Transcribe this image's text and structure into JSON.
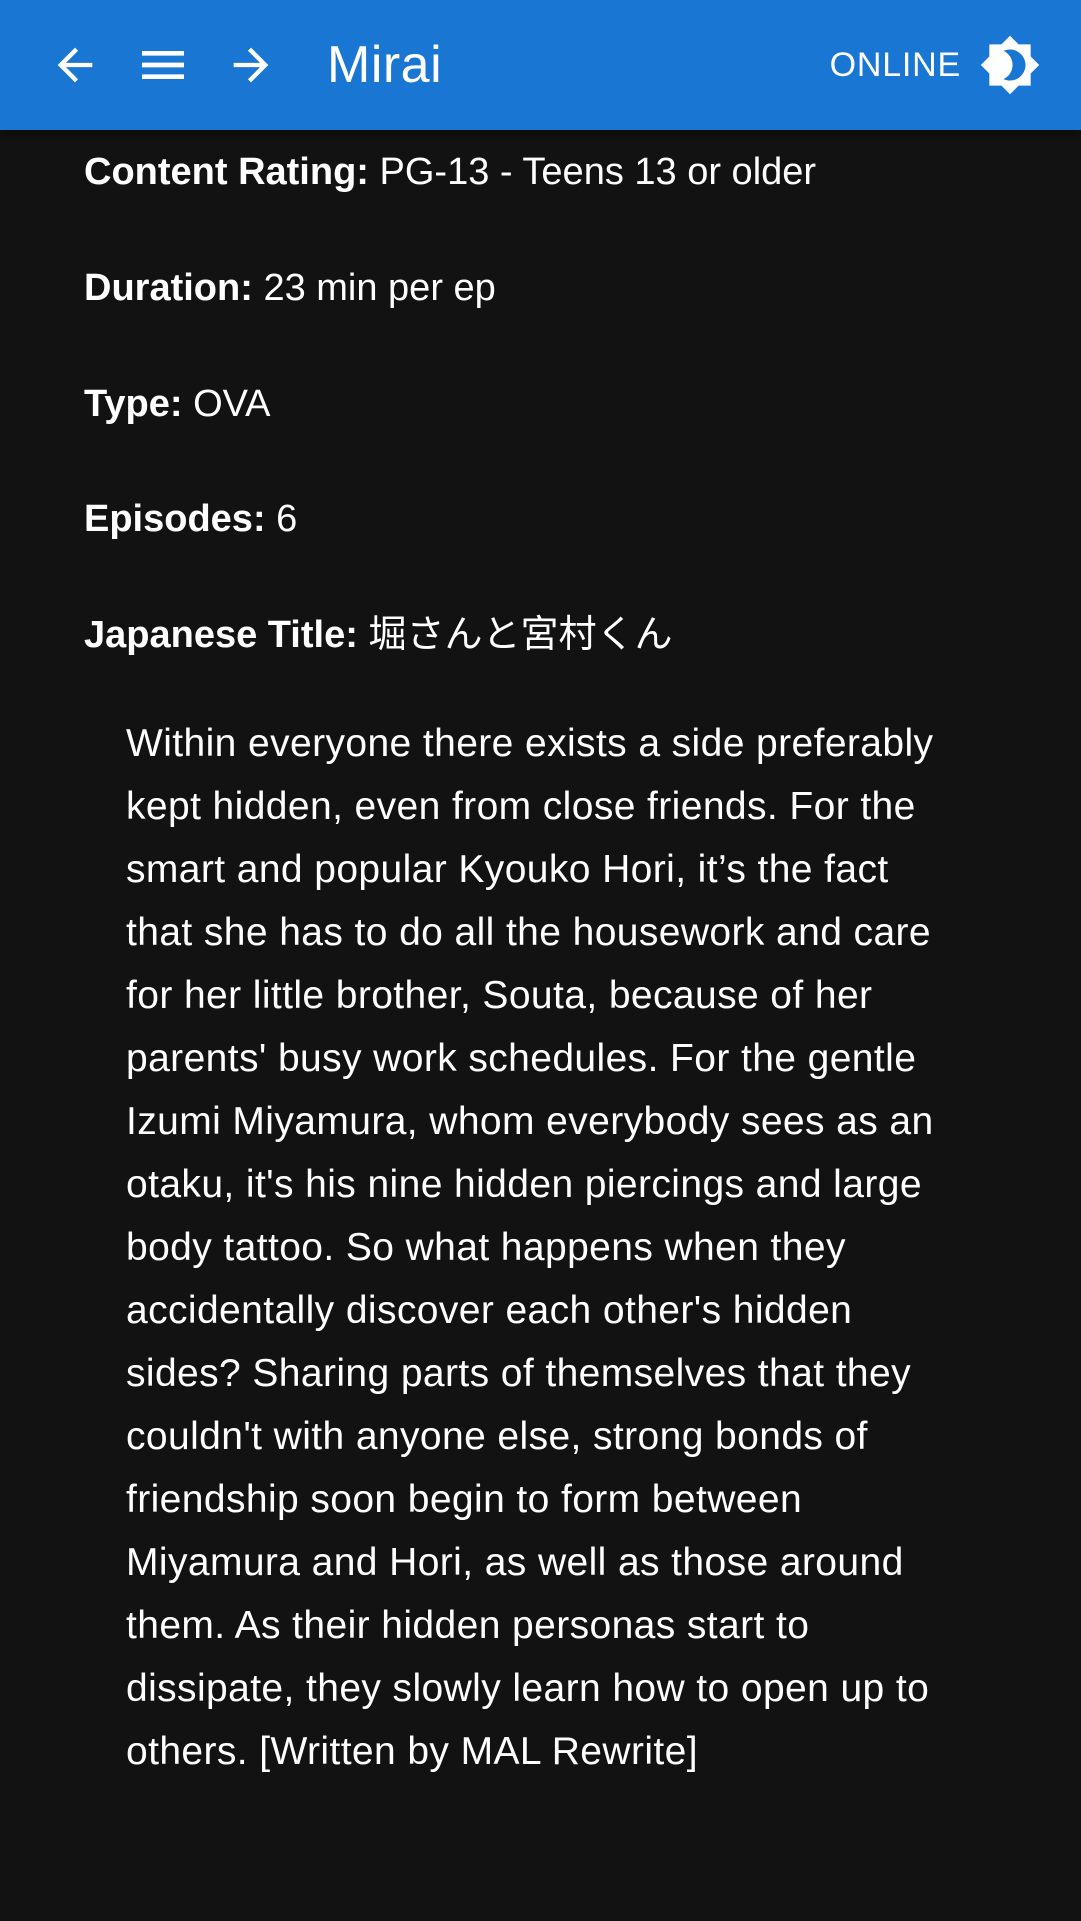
{
  "app_bar": {
    "title": "Mirai",
    "status": "ONLINE",
    "colors": {
      "background": "#1976d2",
      "foreground": "#ffffff"
    },
    "icons": {
      "back": "arrow-left-icon",
      "menu": "hamburger-menu-icon",
      "forward": "arrow-right-icon",
      "theme": "brightness-toggle-icon"
    }
  },
  "details": {
    "content_rating": {
      "label": "Content Rating:",
      "value": "PG-13 - Teens 13 or older"
    },
    "duration": {
      "label": "Duration:",
      "value": "23 min per ep"
    },
    "type": {
      "label": "Type:",
      "value": "OVA"
    },
    "episodes": {
      "label": "Episodes:",
      "value": "6"
    },
    "japanese_title": {
      "label": "Japanese Title:",
      "value": "堀さんと宮村くん"
    }
  },
  "synopsis": "Within everyone there exists a side preferably kept hidden, even from close friends. For the smart and popular Kyouko Hori, it’s the fact that she has to do all the housework and care for her little brother, Souta, because of her parents' busy work schedules. For the gentle Izumi Miyamura, whom everybody sees as an otaku, it's his nine hidden piercings and large body tattoo. So what happens when they accidentally discover each other's hidden sides? Sharing parts of themselves that they couldn't with anyone else, strong bonds of friendship soon begin to form between Miyamura and Hori, as well as those around them. As their hidden personas start to dissipate, they slowly learn how to open up to others. [Written by MAL Rewrite]",
  "theme": {
    "page_background": "#121212",
    "text": "#ffffff"
  }
}
